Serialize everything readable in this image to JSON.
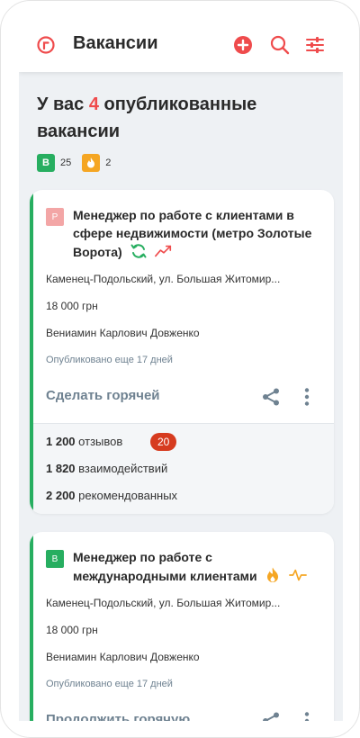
{
  "header": {
    "title": "Вакансии"
  },
  "summary": {
    "prefix": "У вас ",
    "count": "4",
    "suffix": " опубликованные вакансии",
    "badge_standard_letter": "В",
    "standard_count": "25",
    "hot_count": "2"
  },
  "vacancies": [
    {
      "badge_letter": "Р",
      "title": "Менеджер по работе с клиентами в сфере недвижимости (метро Золотые Ворота)",
      "address": "Каменец-Подольский, ул. Большая Житомир...",
      "salary": "18 000 грн",
      "contact": "Вениамин Карлович Довженко",
      "published": "Опубликовано еще 17 дней",
      "action": "Сделать горячей",
      "reviews_num": "1 200",
      "reviews_label": "отзывов",
      "reviews_new": "20",
      "interactions_num": "1 820",
      "interactions_label": "взаимодействий",
      "recommended_num": "2 200",
      "recommended_label": "рекомендованных"
    },
    {
      "badge_letter": "В",
      "title": "Менеджер по работе с международными клиентами",
      "address": "Каменец-Подольский, ул. Большая Житомир...",
      "salary": "18 000 грн",
      "contact": "Вениамин Карлович Довженко",
      "published": "Опубликовано еще 17 дней",
      "action": "Продолжить горячую"
    }
  ],
  "colors": {
    "accent_red": "#ef4b4c",
    "green": "#27ae60",
    "standard_badge": "#27ae60",
    "hot_badge": "#f5a623",
    "premium_badge": "#f3a6a6",
    "new_pill": "#d63b1f",
    "muted_text": "#6f8291"
  }
}
